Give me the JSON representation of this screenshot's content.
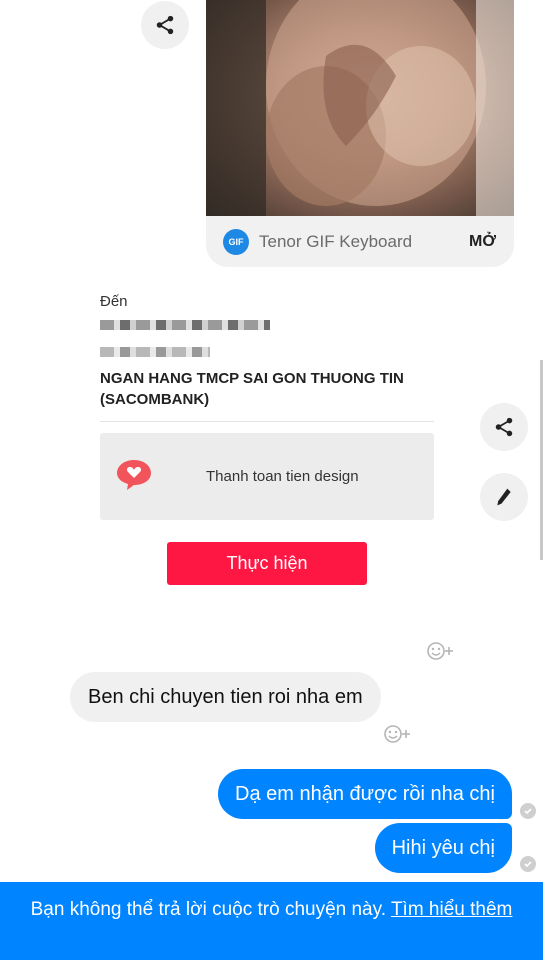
{
  "gif": {
    "badge": "GIF",
    "source_name": "Tenor GIF Keyboard",
    "open_label": "MỞ"
  },
  "transfer": {
    "to_label": "Đến",
    "bank_name": "NGAN HANG TMCP SAI GON THUONG TIN (SACOMBANK)",
    "memo": "Thanh toan tien design",
    "execute_label": "Thực hiện"
  },
  "messages": {
    "incoming": "Ben chi chuyen tien roi nha em",
    "outgoing": [
      "Dạ em nhận được rồi nha chị",
      "Hihi yêu chị"
    ]
  },
  "banner": {
    "text": "Bạn không thể trả lời cuộc trò chuyện này.",
    "link": "Tìm hiểu thêm"
  },
  "colors": {
    "messenger_blue": "#0084ff",
    "execute_red": "#ff1744"
  },
  "icons": [
    "share-icon",
    "pencil-icon",
    "heart-chat-icon",
    "add-reaction-icon",
    "seen-check-icon"
  ]
}
